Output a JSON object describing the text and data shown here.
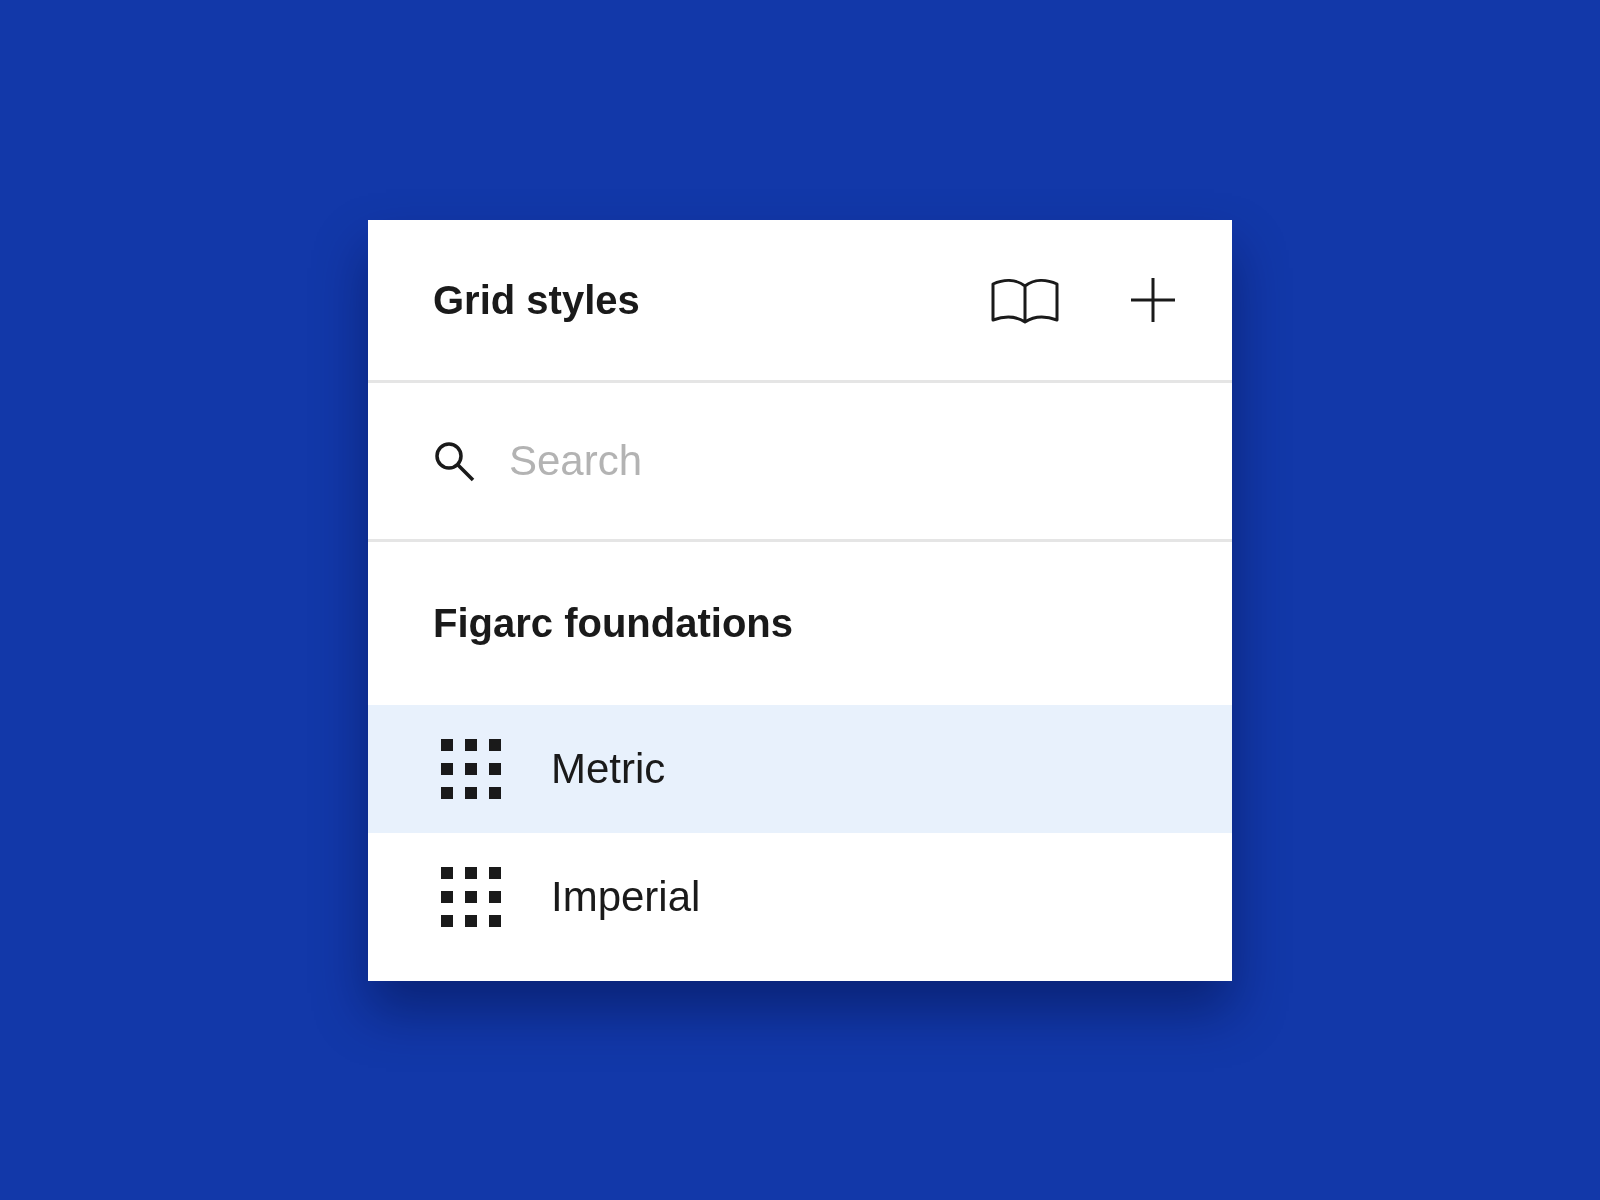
{
  "panel": {
    "title": "Grid styles"
  },
  "search": {
    "placeholder": "Search"
  },
  "section": {
    "title": "Figarc foundations"
  },
  "styles": [
    {
      "name": "Metric",
      "selected": true
    },
    {
      "name": "Imperial",
      "selected": false
    }
  ]
}
